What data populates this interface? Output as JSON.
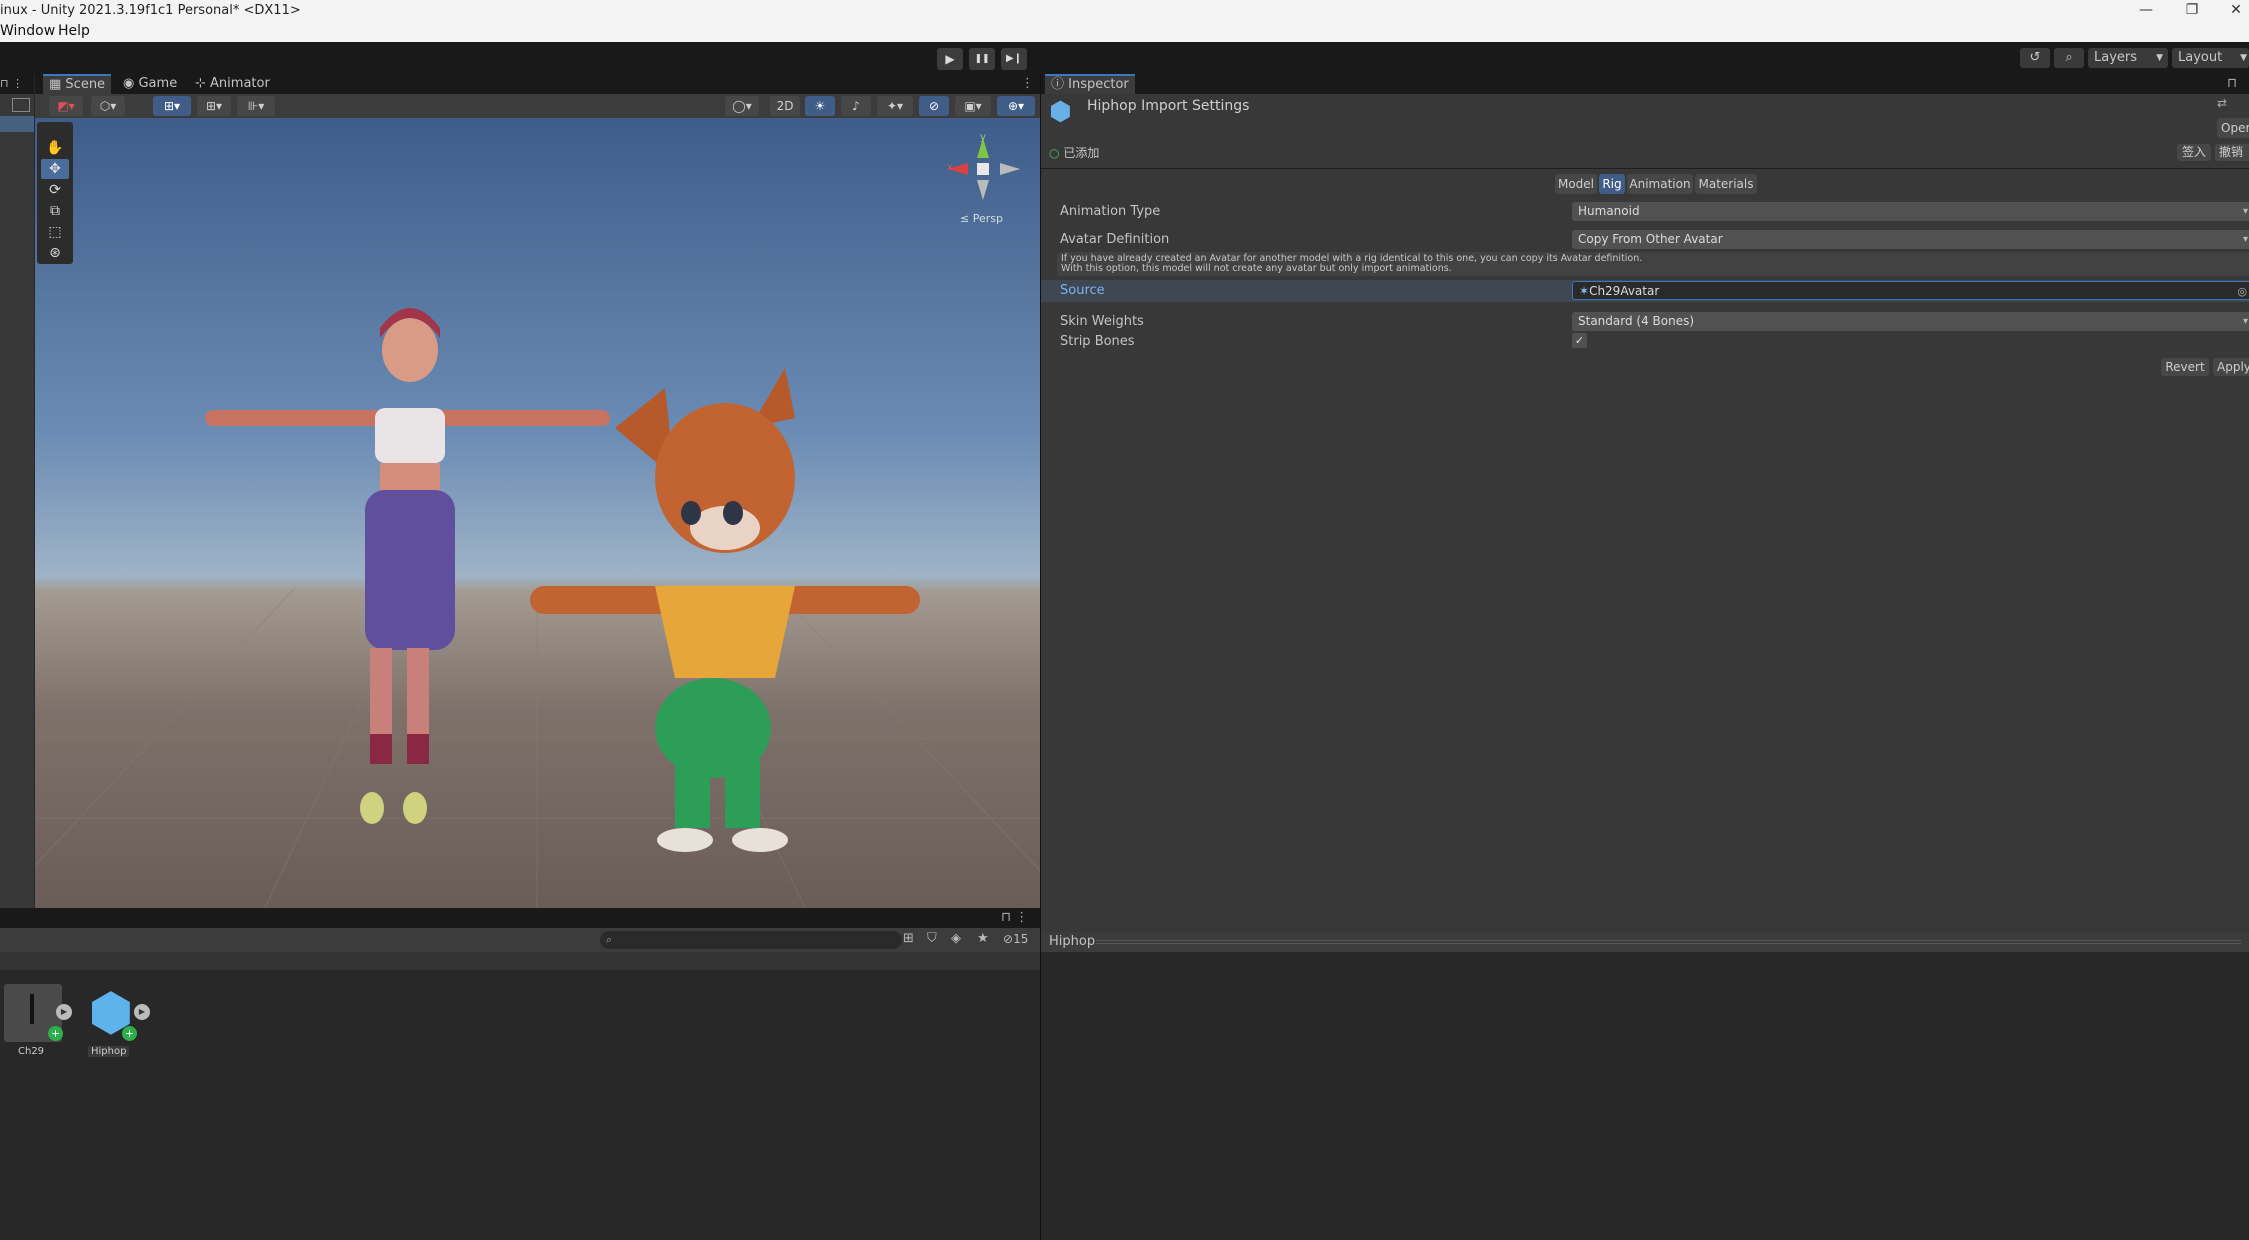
{
  "window": {
    "title": "inux - Unity 2021.3.19f1c1 Personal* <DX11>",
    "minimize_glyph": "—",
    "maximize_glyph": "❐",
    "close_glyph": "✕"
  },
  "menu": {
    "window": "Window",
    "help": "Help"
  },
  "toolbar": {
    "play_glyph": "▶",
    "pause_glyph": "❚❚",
    "step_glyph": "▶❙",
    "history_glyph": "↺",
    "search_glyph": "⌕",
    "layers_label": "Layers",
    "layout_label": "Layout"
  },
  "scene": {
    "tabs": {
      "scene": "Scene",
      "game": "Game",
      "animator": "Animator"
    },
    "toggle_2d": "2D",
    "gizmo_axes": {
      "y": "y",
      "x": "x"
    },
    "persp_label": "≤ Persp"
  },
  "inspector": {
    "tab_label": "Inspector",
    "title": "Hiphop Import Settings",
    "open_label": "Oper",
    "added_label": "已添加",
    "sign_in_label": "签入",
    "revert_cn_label": "撤销",
    "subtabs": [
      "Model",
      "Rig",
      "Animation",
      "Materials"
    ],
    "active_subtab": "Rig",
    "animation_type": {
      "label": "Animation Type",
      "value": "Humanoid"
    },
    "avatar_definition": {
      "label": "Avatar Definition",
      "value": "Copy From Other Avatar"
    },
    "help_line1": "If you have already created an Avatar for another model with a rig identical to this one, you can copy its Avatar definition.",
    "help_line2": "With this option, this model will not create any avatar but only import animations.",
    "source": {
      "label": "Source",
      "value": "Ch29Avatar"
    },
    "skin_weights": {
      "label": "Skin Weights",
      "value": "Standard (4 Bones)"
    },
    "strip_bones": {
      "label": "Strip Bones",
      "checked": true,
      "check_glyph": "✓"
    },
    "revert_label": "Revert",
    "apply_label": "Apply"
  },
  "project": {
    "hidden_count": "15",
    "assets": [
      {
        "name": "Ch29"
      },
      {
        "name": "Hiphop"
      }
    ]
  },
  "preview": {
    "title": "Hiphop"
  },
  "colors": {
    "accent": "#3a79bb",
    "panel": "#383838",
    "dark": "#191919"
  }
}
